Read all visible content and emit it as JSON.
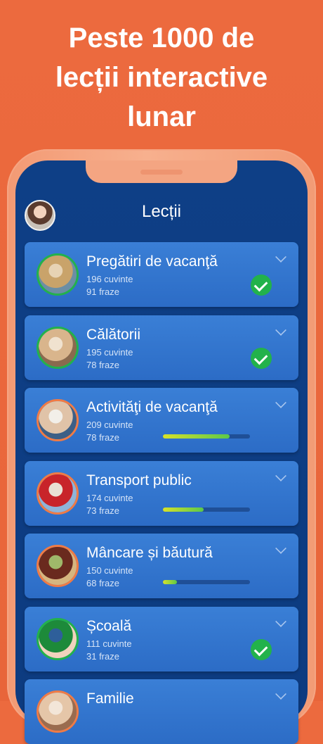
{
  "headline": [
    "Peste 1000 de",
    "lecții interactive",
    "lunar"
  ],
  "screen": {
    "title": "Lecții"
  },
  "lessons": [
    {
      "title": "Pregătiri de vacanţă",
      "words": "196 cuvinte",
      "phrases": "91 fraze",
      "status": "complete",
      "progress": 1.0,
      "thumb_colors": [
        "#c9a36a",
        "#6b8ea5",
        "#e7d3b4"
      ]
    },
    {
      "title": "Călătorii",
      "words": "195 cuvinte",
      "phrases": "78 fraze",
      "status": "complete",
      "progress": 1.0,
      "thumb_colors": [
        "#d9b58c",
        "#8a6a4e",
        "#f0e2cf"
      ]
    },
    {
      "title": "Activităţi de vacanţă",
      "words": "209 cuvinte",
      "phrases": "78 fraze",
      "status": "in-progress",
      "progress": 0.77,
      "thumb_colors": [
        "#e0c3a8",
        "#3d5f86",
        "#f2efe9"
      ]
    },
    {
      "title": "Transport public",
      "words": "174 cuvinte",
      "phrases": "73 fraze",
      "status": "in-progress",
      "progress": 0.47,
      "thumb_colors": [
        "#c8242a",
        "#8fb4d9",
        "#e9e1d4"
      ]
    },
    {
      "title": "Mâncare și băutură",
      "words": "150 cuvinte",
      "phrases": "68 fraze",
      "status": "in-progress",
      "progress": 0.16,
      "thumb_colors": [
        "#6a2a1e",
        "#d7b67f",
        "#9fb86a"
      ]
    },
    {
      "title": "Școală",
      "words": "111 cuvinte",
      "phrases": "31 fraze",
      "status": "complete",
      "progress": 1.0,
      "thumb_colors": [
        "#1d8a3a",
        "#f1d3bd",
        "#2e5f9a"
      ]
    },
    {
      "title": "Familie",
      "words": "",
      "phrases": "",
      "status": "in-progress",
      "progress": 0,
      "thumb_colors": [
        "#e5c6a8",
        "#9a6c4f",
        "#f3e6d8"
      ]
    }
  ]
}
